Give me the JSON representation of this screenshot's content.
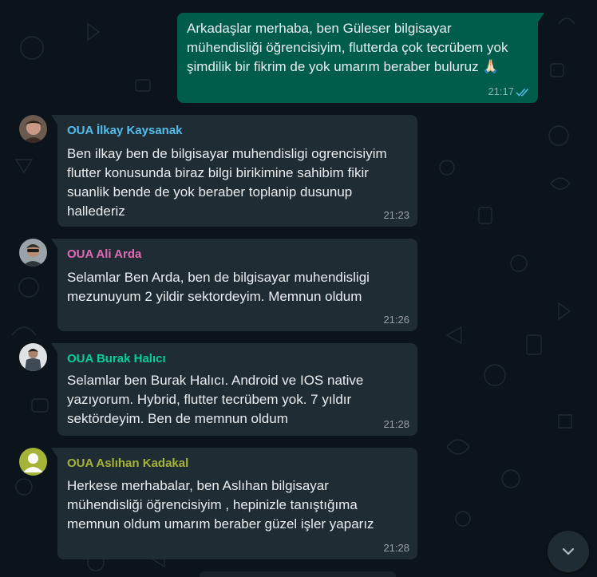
{
  "colors": {
    "background": "#0b141a",
    "bubble_outgoing": "#005c4b",
    "bubble_incoming": "#202c33",
    "text_primary": "#e9edef",
    "read_ticks": "#53bdeb"
  },
  "messages": [
    {
      "direction": "outgoing",
      "lines": "Arkadaşlar merhaba, ben Güleser bilgisayar\nmühendisliği öğrencisiyim, flutterda çok tecrübem yok\nşimdilik bir fikrim de yok umarım beraber buluruz 🙏🏻",
      "time": "21:17",
      "status_icon": "double-check-read-icon"
    },
    {
      "direction": "incoming",
      "sender": "OUA İlkay Kaysanak",
      "sender_color": "#53bdeb",
      "lines": "Ben ilkay ben de bilgisayar muhendisligi ogrencisiyim\nflutter konusunda biraz bilgi birikimine sahibim fikir\nsuanlik bende de yok beraber toplanip dusunup\nhallederiz",
      "time": "21:23",
      "avatar_icon": "profile-photo-icon"
    },
    {
      "direction": "incoming",
      "sender": "OUA Ali Arda",
      "sender_color": "#e26ab6",
      "lines": "Selamlar Ben Arda, ben de bilgisayar muhendisligi\nmezunuyum 2 yildir sektordeyim. Memnun oldum",
      "time": "21:26",
      "avatar_icon": "profile-photo-icon"
    },
    {
      "direction": "incoming",
      "sender": "OUA Burak Halıcı",
      "sender_color": "#06cf9c",
      "lines": "Selamlar ben Burak Halıcı. Android ve IOS native\nyazıyorum. Hybrid, flutter tecrübem yok. 7 yıldır\nsektördeyim. Ben de memnun oldum",
      "time": "21:28",
      "avatar_icon": "profile-photo-icon"
    },
    {
      "direction": "incoming",
      "sender": "OUA Aslıhan Kadakal",
      "sender_color": "#a5b337",
      "lines": "Herkese merhabalar, ben Aslıhan bilgisayar\nmühendisliği öğrencisiyim , hepinizle tanıştığıma\nmemnun oldum umarım beraber güzel işler yaparız",
      "time": "21:28",
      "avatar_icon": "default-avatar-icon"
    }
  ],
  "scroll_button_icon": "chevron-down-icon"
}
